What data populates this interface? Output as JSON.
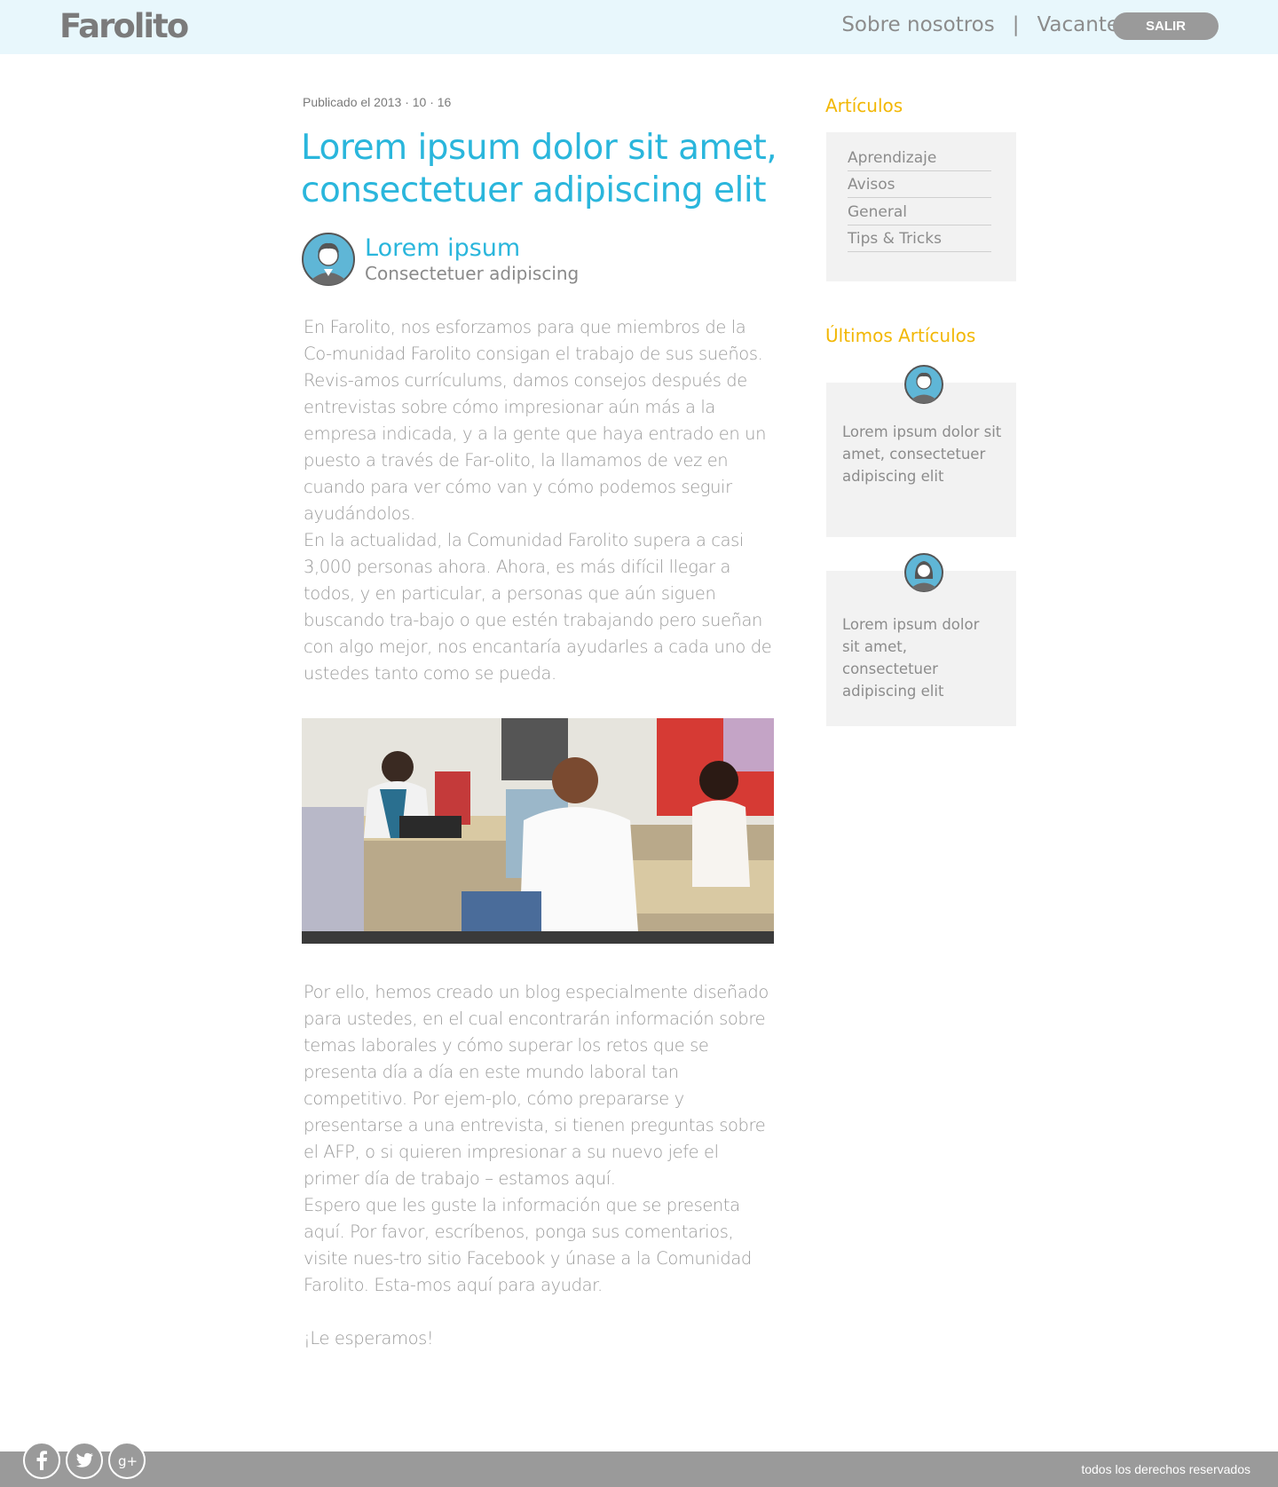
{
  "header": {
    "logo": "Farolito",
    "nav": {
      "about": "Sobre nosotros",
      "separator": "|",
      "jobs": "Vacantes"
    },
    "logout_label": "SALIR"
  },
  "article": {
    "published": "Publicado  el 2013 · 10 · 16",
    "title": "Lorem ipsum dolor sit amet, consectetuer adipiscing elit",
    "author_name": "Lorem ipsum",
    "author_subtitle": "Consectetuer adipiscing",
    "paragraphs": [
      "En Farolito, nos esforzamos para que miembros de la Co-munidad Farolito consigan el trabajo de sus sueños. Revis-amos currículums, damos consejos después de entrevistas sobre cómo impresionar aún más a la empresa indicada, y a la gente que haya entrado en un puesto a través de Far-olito, la llamamos de vez en cuando para ver cómo van y cómo podemos seguir ayudándolos.",
      "En la actualidad, la Comunidad Farolito supera a casi 3,000 personas ahora. Ahora, es más difícil llegar a todos, y en particular, a personas que aún siguen buscando tra-bajo o que estén trabajando pero sueñan con algo mejor, nos encantaría ayudarles a cada uno de ustedes tanto como se pueda.",
      "Por ello, hemos creado un blog especialmente diseñado para ustedes, en el cual encontrarán información sobre temas laborales y cómo superar los retos que se presenta día a día en este mundo laboral tan competitivo. Por ejem-plo, cómo prepararse y presentarse a una entrevista, si tienen preguntas sobre el AFP, o si quieren impresionar a su nuevo jefe el primer día de trabajo – estamos aquí.",
      "Espero que les guste la información que se presenta aquí. Por favor, escríbenos, ponga sus comentarios, visite nues-tro sitio Facebook y únase a la Comunidad Farolito. Esta-mos aquí para ayudar.",
      "¡Le esperamos!"
    ]
  },
  "sidebar": {
    "categories_heading": "Artículos",
    "categories": [
      "Aprendizaje",
      "Avisos",
      "General",
      "Tips & Tricks"
    ],
    "latest_heading": "Últimos Artículos",
    "latest": [
      "Lorem ipsum dolor sit amet, consectetuer adipiscing elit",
      "Lorem ipsum dolor sit amet, consectetuer adipiscing elit"
    ]
  },
  "footer": {
    "social": [
      "facebook-icon",
      "twitter-icon",
      "google-plus-icon"
    ],
    "copyright": "todos los derechos reservados"
  },
  "colors": {
    "accent": "#2ab6dc",
    "sidebar_heading": "#f2b705",
    "header_bg": "#e8f7fc",
    "footer_bg": "#9a9a9a"
  }
}
